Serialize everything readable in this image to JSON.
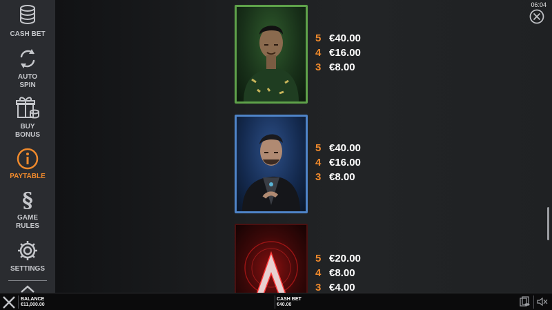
{
  "clock": "06:04",
  "sidebar": {
    "items": [
      {
        "label": "CASH BET",
        "icon": "coins-stack-icon",
        "active": false
      },
      {
        "label": "AUTO\nSPIN",
        "icon": "autospin-icon",
        "active": false
      },
      {
        "label": "BUY\nBONUS",
        "icon": "gift-coins-icon",
        "active": false
      },
      {
        "label": "PAYTABLE",
        "icon": "info-icon",
        "active": true
      },
      {
        "label": "GAME\nRULES",
        "icon": "section-icon",
        "active": false
      },
      {
        "label": "SETTINGS",
        "icon": "gear-icon",
        "active": false
      }
    ]
  },
  "paytable": {
    "symbols": [
      {
        "name": "green-character",
        "payouts": [
          {
            "count": "5",
            "amount": "€40.00"
          },
          {
            "count": "4",
            "amount": "€16.00"
          },
          {
            "count": "3",
            "amount": "€8.00"
          }
        ]
      },
      {
        "name": "blue-character",
        "payouts": [
          {
            "count": "5",
            "amount": "€40.00"
          },
          {
            "count": "4",
            "amount": "€16.00"
          },
          {
            "count": "3",
            "amount": "€8.00"
          }
        ]
      },
      {
        "name": "red-a-symbol",
        "payouts": [
          {
            "count": "5",
            "amount": "€20.00"
          },
          {
            "count": "4",
            "amount": "€8.00"
          },
          {
            "count": "3",
            "amount": "€4.00"
          }
        ]
      }
    ]
  },
  "bottombar": {
    "balance_label": "BALANCE",
    "balance_value": "€11,000.00",
    "cashbet_label": "CASH BET",
    "cashbet_value": "€40.00"
  },
  "colors": {
    "accent": "#f08a2c",
    "sidebar_bg": "#2a2c30"
  }
}
